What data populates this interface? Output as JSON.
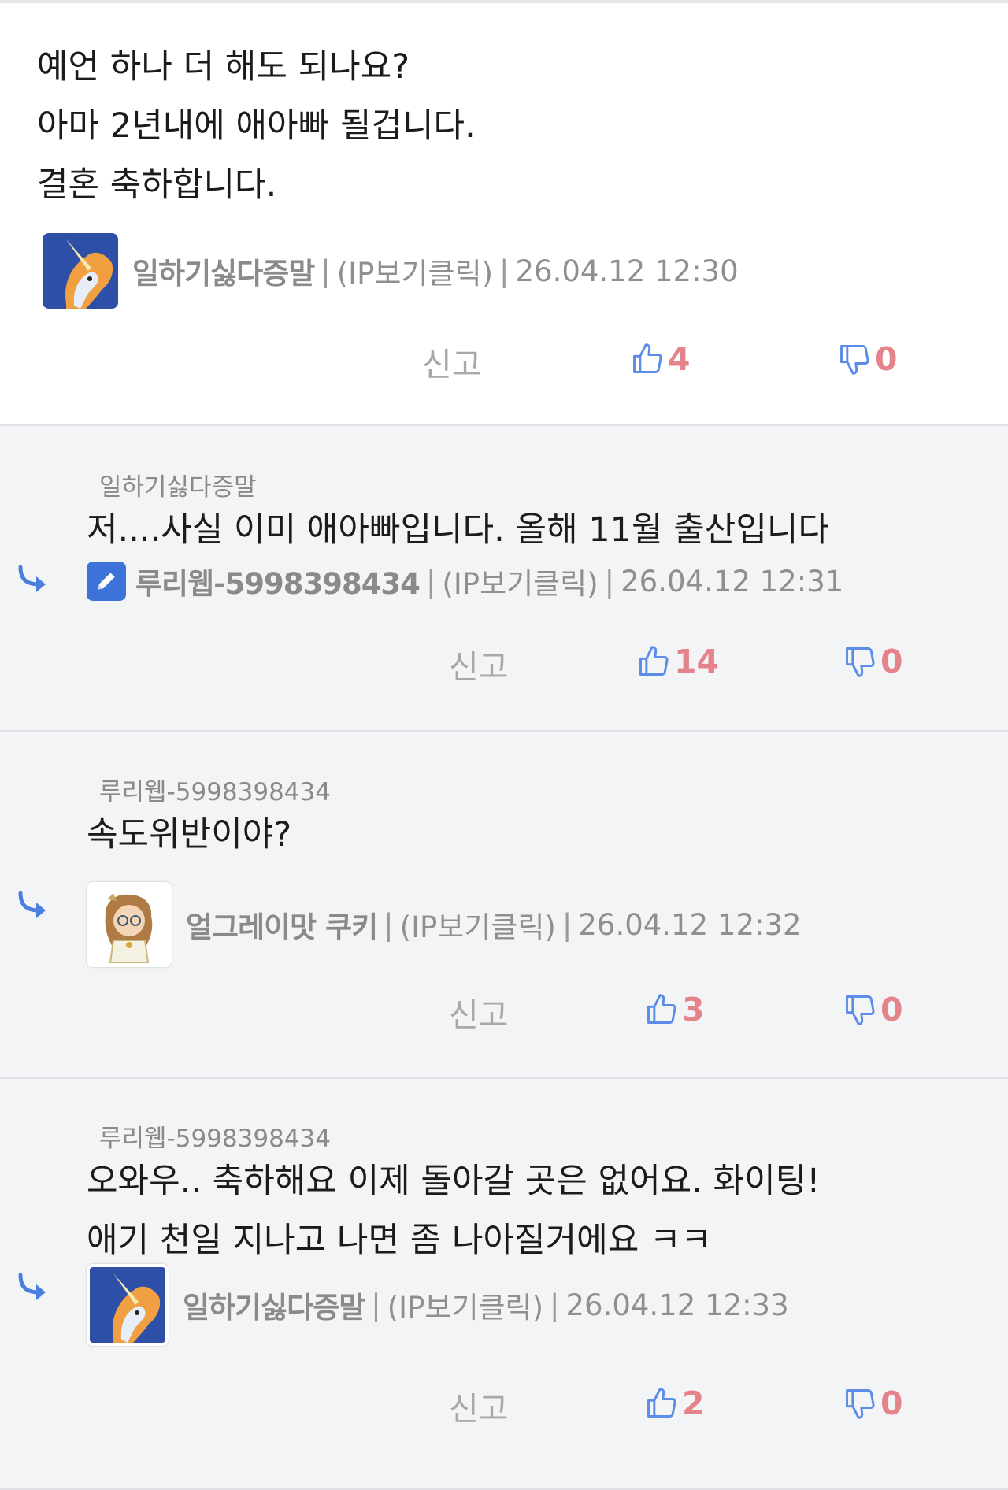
{
  "report_label": "신고",
  "separator": "|",
  "ip_label": "(IP보기클릭)",
  "icons": {
    "reply": "reply-arrow-icon",
    "like": "thumbs-up-icon",
    "dislike": "thumbs-down-icon",
    "edit": "pencil-icon"
  },
  "colors": {
    "vote_count": "#e5838b",
    "icon_blue": "#5b8de8",
    "reply_bg": "#f3f4f6"
  },
  "comments": [
    {
      "lines": [
        "예언 하나 더 해도 되나요?",
        "아마 2년내에 애아빠 될겁니다.",
        "결혼 축하합니다."
      ],
      "author": "일하기싫다증말",
      "timestamp": "26.04.12 12:30",
      "likes": "4",
      "dislikes": "0"
    },
    {
      "reply_to": "일하기싫다증말",
      "lines": [
        "저....사실 이미 애아빠입니다. 올해 11월 출산입니다"
      ],
      "author": "루리웹-5998398434",
      "timestamp": "26.04.12 12:31",
      "likes": "14",
      "dislikes": "0"
    },
    {
      "reply_to": "루리웹-5998398434",
      "lines": [
        "속도위반이야?"
      ],
      "author": "얼그레이맛 쿠키",
      "timestamp": "26.04.12 12:32",
      "likes": "3",
      "dislikes": "0"
    },
    {
      "reply_to": "루리웹-5998398434",
      "lines": [
        "오와우.. 축하해요 이제 돌아갈 곳은 없어요. 화이팅!",
        "애기 천일 지나고 나면 좀 나아질거에요 ㅋㅋ"
      ],
      "author": "일하기싫다증말",
      "timestamp": "26.04.12 12:33",
      "likes": "2",
      "dislikes": "0"
    }
  ]
}
